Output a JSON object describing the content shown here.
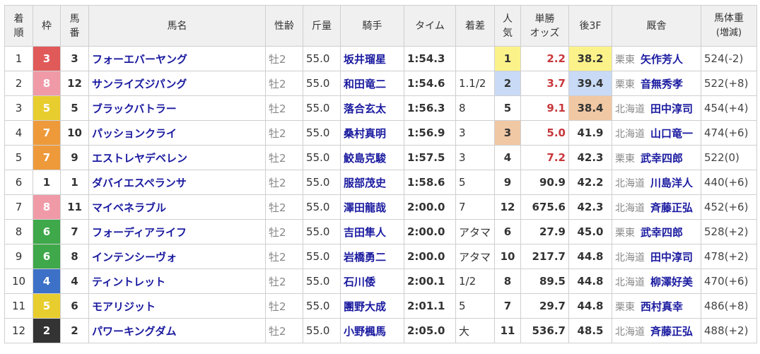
{
  "headers": {
    "rank": [
      "着",
      "順"
    ],
    "waku": "枠",
    "num": [
      "馬",
      "番"
    ],
    "name": "馬名",
    "sexage": "性齢",
    "kinryo": "斤量",
    "jockey": "騎手",
    "time": "タイム",
    "margin": "着差",
    "pop": [
      "人",
      "気"
    ],
    "odds": [
      "単勝",
      "オッズ"
    ],
    "last3f": "後3F",
    "trainer": "厩舎",
    "weight": [
      "馬体重",
      "(増減)"
    ]
  },
  "colors": {
    "waku": {
      "1": {
        "bg": "#ffffff",
        "fg": "#333333"
      },
      "2": {
        "bg": "#333333",
        "fg": "#ffffff"
      },
      "3": {
        "bg": "#e05a5a",
        "fg": "#ffffff"
      },
      "4": {
        "bg": "#3d71c8",
        "fg": "#ffffff"
      },
      "5": {
        "bg": "#e8cd2e",
        "fg": "#ffffff"
      },
      "6": {
        "bg": "#3ea84a",
        "fg": "#ffffff"
      },
      "7": {
        "bg": "#ee9a3a",
        "fg": "#ffffff"
      },
      "8": {
        "bg": "#f09aa8",
        "fg": "#ffffff"
      }
    },
    "pop_highlight": {
      "1": "#fbf38a",
      "2": "#c8daf5",
      "3": "#f1c8a4"
    },
    "last3f_highlight": {
      "1": "#fbf38a",
      "2": "#f1c8a4",
      "3": "#c8daf5"
    },
    "odds_red": "#c8373b"
  },
  "rows": [
    {
      "rank": "1",
      "waku": "3",
      "num": "3",
      "name": "フォーエバーヤング",
      "sexage": "牡2",
      "kinryo": "55.0",
      "jockey": "坂井瑠星",
      "time": "1:54.3",
      "margin": "",
      "pop": "1",
      "odds": "2.2",
      "last3f": "38.2",
      "region": "栗東",
      "trainer": "矢作芳人",
      "weight": "524(-2)"
    },
    {
      "rank": "2",
      "waku": "8",
      "num": "12",
      "name": "サンライズジパング",
      "sexage": "牡2",
      "kinryo": "55.0",
      "jockey": "和田竜二",
      "time": "1:54.6",
      "margin": "1.1/2",
      "pop": "2",
      "odds": "3.7",
      "last3f": "39.4",
      "region": "栗東",
      "trainer": "音無秀孝",
      "weight": "522(+8)"
    },
    {
      "rank": "3",
      "waku": "5",
      "num": "5",
      "name": "ブラックバトラー",
      "sexage": "牡2",
      "kinryo": "55.0",
      "jockey": "落合玄太",
      "time": "1:56.3",
      "margin": "8",
      "pop": "5",
      "odds": "9.1",
      "last3f": "38.4",
      "region": "北海道",
      "trainer": "田中淳司",
      "weight": "454(+4)"
    },
    {
      "rank": "4",
      "waku": "7",
      "num": "10",
      "name": "パッションクライ",
      "sexage": "牡2",
      "kinryo": "55.0",
      "jockey": "桑村真明",
      "time": "1:56.9",
      "margin": "3",
      "pop": "3",
      "odds": "5.0",
      "last3f": "41.9",
      "region": "北海道",
      "trainer": "山口竜一",
      "weight": "474(+6)"
    },
    {
      "rank": "5",
      "waku": "7",
      "num": "9",
      "name": "エストレヤデベレン",
      "sexage": "牡2",
      "kinryo": "55.0",
      "jockey": "鮫島克駿",
      "time": "1:57.5",
      "margin": "3",
      "pop": "4",
      "odds": "7.2",
      "last3f": "42.3",
      "region": "栗東",
      "trainer": "武幸四郎",
      "weight": "522(0)"
    },
    {
      "rank": "6",
      "waku": "1",
      "num": "1",
      "name": "ダバイエスペランサ",
      "sexage": "牡2",
      "kinryo": "55.0",
      "jockey": "服部茂史",
      "time": "1:58.6",
      "margin": "5",
      "pop": "9",
      "odds": "90.9",
      "last3f": "42.2",
      "region": "北海道",
      "trainer": "川島洋人",
      "weight": "440(+6)"
    },
    {
      "rank": "7",
      "waku": "8",
      "num": "11",
      "name": "マイベネラブル",
      "sexage": "牡2",
      "kinryo": "55.0",
      "jockey": "澤田龍哉",
      "time": "2:00.0",
      "margin": "7",
      "pop": "12",
      "odds": "675.6",
      "last3f": "42.3",
      "region": "北海道",
      "trainer": "斉藤正弘",
      "weight": "452(+6)"
    },
    {
      "rank": "8",
      "waku": "6",
      "num": "7",
      "name": "フォーディアライフ",
      "sexage": "牡2",
      "kinryo": "55.0",
      "jockey": "吉田隼人",
      "time": "2:00.0",
      "margin": "アタマ",
      "pop": "6",
      "odds": "27.9",
      "last3f": "45.0",
      "region": "栗東",
      "trainer": "武幸四郎",
      "weight": "528(+2)"
    },
    {
      "rank": "9",
      "waku": "6",
      "num": "8",
      "name": "インテンシーヴォ",
      "sexage": "牡2",
      "kinryo": "55.0",
      "jockey": "岩橋勇二",
      "time": "2:00.0",
      "margin": "アタマ",
      "pop": "10",
      "odds": "217.7",
      "last3f": "44.8",
      "region": "北海道",
      "trainer": "田中淳司",
      "weight": "478(+2)"
    },
    {
      "rank": "10",
      "waku": "4",
      "num": "4",
      "name": "ティントレット",
      "sexage": "牡2",
      "kinryo": "55.0",
      "jockey": "石川倭",
      "time": "2:00.1",
      "margin": "1/2",
      "pop": "8",
      "odds": "89.5",
      "last3f": "44.8",
      "region": "北海道",
      "trainer": "柳澤好美",
      "weight": "470(+6)"
    },
    {
      "rank": "11",
      "waku": "5",
      "num": "6",
      "name": "モアリジット",
      "sexage": "牡2",
      "kinryo": "55.0",
      "jockey": "團野大成",
      "time": "2:01.1",
      "margin": "5",
      "pop": "7",
      "odds": "29.7",
      "last3f": "44.8",
      "region": "栗東",
      "trainer": "西村真幸",
      "weight": "486(+8)"
    },
    {
      "rank": "12",
      "waku": "2",
      "num": "2",
      "name": "パワーキングダム",
      "sexage": "牡2",
      "kinryo": "55.0",
      "jockey": "小野楓馬",
      "time": "2:05.0",
      "margin": "大",
      "pop": "11",
      "odds": "536.7",
      "last3f": "48.5",
      "region": "北海道",
      "trainer": "斉藤正弘",
      "weight": "488(+2)"
    }
  ]
}
